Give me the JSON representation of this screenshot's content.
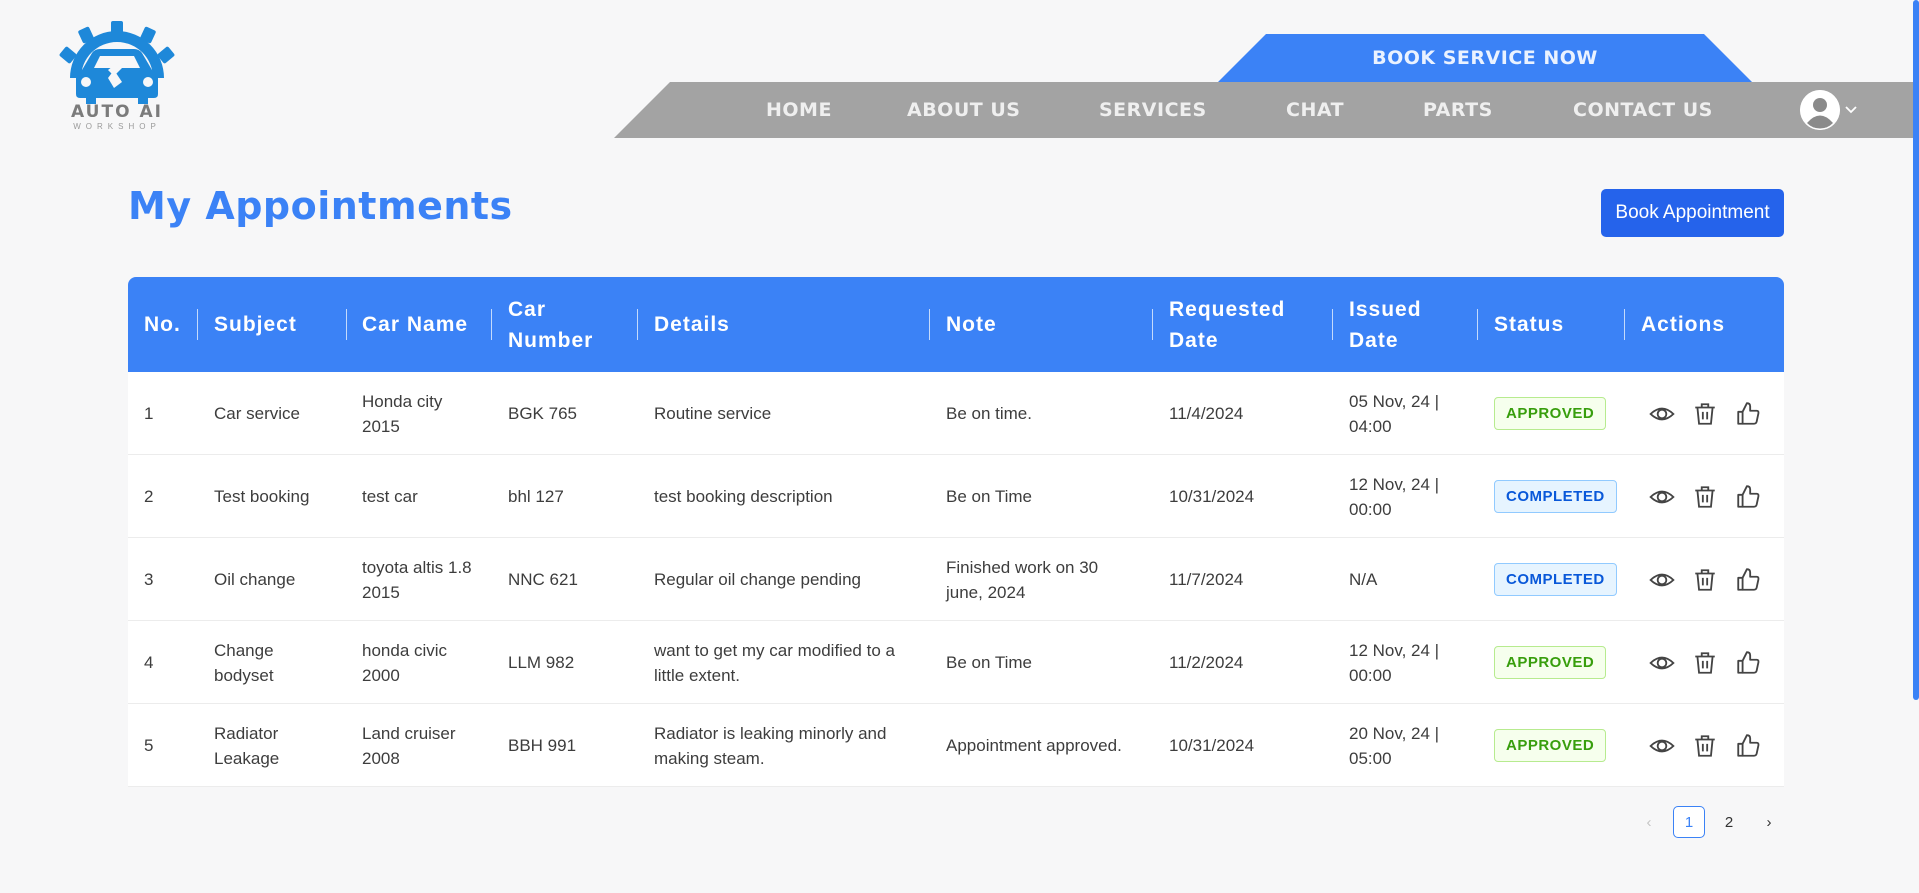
{
  "brand": {
    "name": "AUTO AI",
    "tagline": "WORKSHOP"
  },
  "header": {
    "cta": "BOOK SERVICE NOW",
    "nav": [
      "HOME",
      "ABOUT US",
      "SERVICES",
      "CHAT",
      "PARTS",
      "CONTACT US"
    ],
    "user_icon": "user-avatar-icon",
    "dropdown_icon": "chevron-down-icon"
  },
  "main": {
    "title": "My Appointments",
    "book_button": "Book Appointment"
  },
  "table": {
    "headers": [
      "No.",
      "Subject",
      "Car Name",
      "Car Number",
      "Details",
      "Note",
      "Requested Date",
      "Issued Date",
      "Status",
      "Actions"
    ],
    "rows": [
      {
        "no": "1",
        "subject": "Car service",
        "car_name": "Honda city 2015",
        "car_number": "BGK 765",
        "details": "Routine service",
        "note": "Be on time.",
        "requested": "11/4/2024",
        "issued": "05 Nov, 24 | 04:00",
        "status": "APPROVED"
      },
      {
        "no": "2",
        "subject": "Test booking",
        "car_name": "test car",
        "car_number": "bhl 127",
        "details": "test booking description",
        "note": "Be on Time",
        "requested": "10/31/2024",
        "issued": "12 Nov, 24 | 00:00",
        "status": "COMPLETED"
      },
      {
        "no": "3",
        "subject": "Oil change",
        "car_name": "toyota altis 1.8 2015",
        "car_number": "NNC 621",
        "details": "Regular oil change pending",
        "note": "Finished work on 30 june, 2024",
        "requested": "11/7/2024",
        "issued": "N/A",
        "status": "COMPLETED"
      },
      {
        "no": "4",
        "subject": "Change bodyset",
        "car_name": "honda civic 2000",
        "car_number": "LLM 982",
        "details": "want to get my car modified to a little extent.",
        "note": "Be on Time",
        "requested": "11/2/2024",
        "issued": "12 Nov, 24 | 00:00",
        "status": "APPROVED"
      },
      {
        "no": "5",
        "subject": "Radiator Leakage",
        "car_name": "Land cruiser 2008",
        "car_number": "BBH 991",
        "details": "Radiator is leaking minorly and making steam.",
        "note": "Appointment approved.",
        "requested": "10/31/2024",
        "issued": "20 Nov, 24 | 05:00",
        "status": "APPROVED"
      }
    ],
    "action_icons": [
      "eye-icon",
      "trash-icon",
      "thumbs-up-icon"
    ]
  },
  "pagination": {
    "prev": "‹",
    "pages": [
      "1",
      "2"
    ],
    "current": "1",
    "next": "›"
  },
  "colors": {
    "primary": "#3b82f6",
    "button": "#2563eb",
    "nav_bg": "#a3a3a3",
    "approved": "#389e0d",
    "completed": "#0958d9"
  }
}
